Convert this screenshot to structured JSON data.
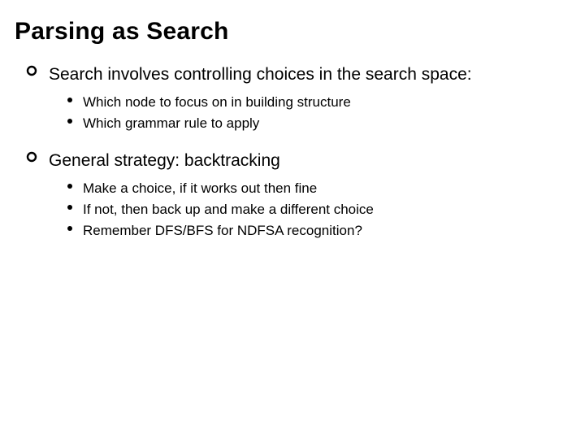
{
  "title": "Parsing as Search",
  "points": [
    {
      "text": "Search involves controlling choices in the search space:",
      "sub": [
        "Which node to focus on in building structure",
        "Which grammar rule to apply"
      ]
    },
    {
      "text": "General strategy: backtracking",
      "sub": [
        "Make a choice, if it works out then fine",
        "If not, then back up and make a different choice",
        "Remember DFS/BFS for NDFSA recognition?"
      ]
    }
  ]
}
